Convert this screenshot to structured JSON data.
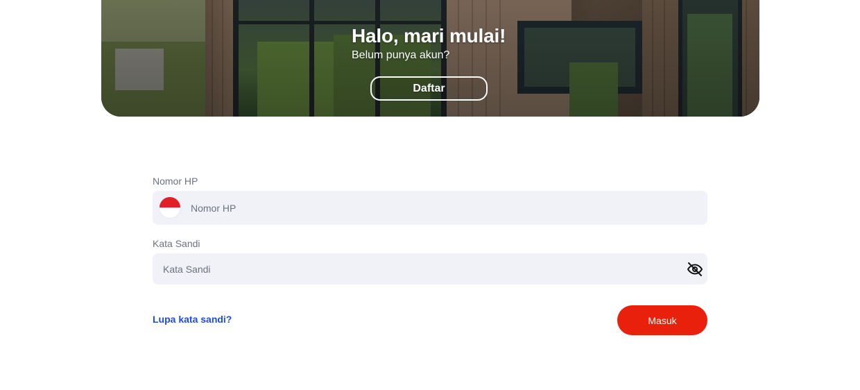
{
  "hero": {
    "title": "Halo, mari mulai!",
    "subtitle": "Belum punya akun?",
    "register_label": "Daftar"
  },
  "form": {
    "phone": {
      "label": "Nomor HP",
      "placeholder": "Nomor HP",
      "country_flag_icon": "indonesia-flag-icon"
    },
    "password": {
      "label": "Kata Sandi",
      "placeholder": "Kata Sandi",
      "toggle_icon": "eye-off-icon"
    },
    "forgot_password_label": "Lupa kata sandi?",
    "login_label": "Masuk"
  },
  "colors": {
    "primary_red": "#e8200c",
    "link_blue": "#1d4ed8",
    "input_background": "#f0f2f7",
    "label_gray": "#6b7280"
  }
}
